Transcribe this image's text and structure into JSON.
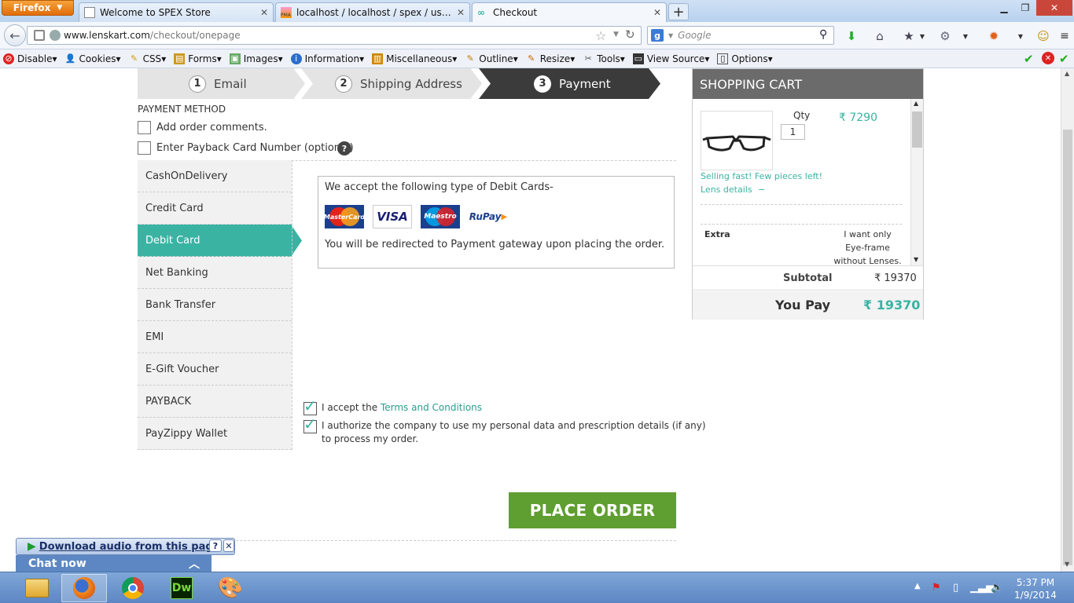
{
  "browser": {
    "firefox_label": "Firefox",
    "tabs": [
      {
        "title": "Welcome to SPEX Store"
      },
      {
        "title": "localhost / localhost / spex / user_inf..."
      },
      {
        "title": "Checkout"
      }
    ],
    "url_domain": "www.lenskart.com",
    "url_path": "/checkout/onepage",
    "search_placeholder": "Google",
    "devbar": [
      "Disable",
      "Cookies",
      "CSS",
      "Forms",
      "Images",
      "Information",
      "Miscellaneous",
      "Outline",
      "Resize",
      "Tools",
      "View Source",
      "Options"
    ]
  },
  "steps": [
    {
      "num": "1",
      "label": "Email"
    },
    {
      "num": "2",
      "label": "Shipping Address"
    },
    {
      "num": "3",
      "label": "Payment"
    }
  ],
  "payment": {
    "section_title": "PAYMENT METHOD",
    "order_comments_label": "Add order comments.",
    "payback_label": "Enter Payback Card Number (optional)",
    "help_icon": "?",
    "methods": [
      "CashOnDelivery",
      "Credit Card",
      "Debit Card",
      "Net Banking",
      "Bank Transfer",
      "EMI",
      "E-Gift Voucher",
      "PAYBACK",
      "PayZippy Wallet"
    ],
    "active_method": "Debit Card",
    "debit_heading": "We accept the following type of Debit Cards-",
    "card_logos": [
      "MasterCard",
      "VISA",
      "Maestro",
      "RuPay"
    ],
    "redirect_note": "You will be redirected to Payment gateway upon placing the order.",
    "accept_prefix": "I accept the",
    "terms_link": "Terms and Conditions",
    "authorize_line1": "I authorize the company to use my personal data and prescription details (if any)",
    "authorize_line2": "to process my order.",
    "place_order": "PLACE ORDER"
  },
  "cart": {
    "title": "SHOPPING CART",
    "qty_label": "Qty",
    "qty_value": "1",
    "price": "₹ 7290",
    "selling_fast": "Selling fast! Few pieces left!",
    "lens_details": "Lens details",
    "extra_label": "Extra",
    "extra_desc_1": "I want only",
    "extra_desc_2": "Eye-frame",
    "extra_desc_3": "without Lenses.",
    "subtotal_label": "Subtotal",
    "subtotal_value": "₹ 19370",
    "youpay_label": "You Pay",
    "youpay_value": "₹ 19370"
  },
  "overlays": {
    "download_audio": "Download audio from this page",
    "chat_now": "Chat now"
  },
  "taskbar": {
    "time": "5:37 PM",
    "date": "1/9/2014"
  },
  "colors": {
    "accent_teal": "#3ab3a3",
    "place_order_green": "#5f9e30",
    "cart_header": "#6b6b6b"
  }
}
